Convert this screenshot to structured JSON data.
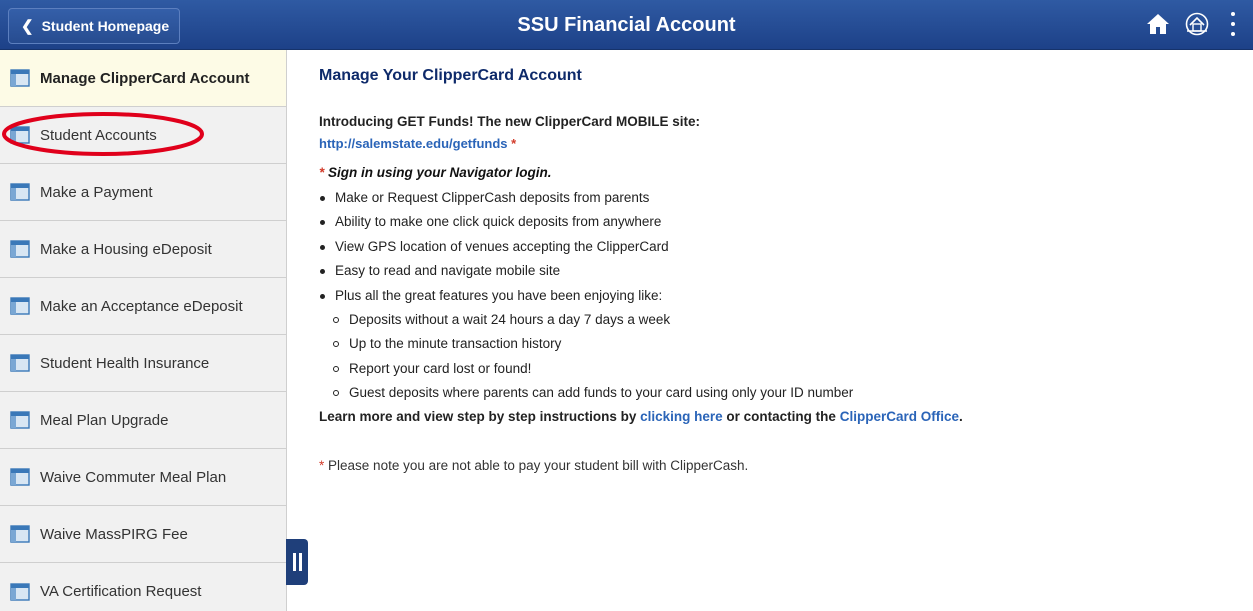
{
  "header": {
    "back_label": "Student Homepage",
    "title": "SSU Financial Account",
    "icons": [
      "home-icon",
      "navbar-icon",
      "actions-menu-icon"
    ],
    "bg_color": "#1d4188"
  },
  "sidebar": {
    "items": [
      {
        "label": "Manage ClipperCard Account",
        "active": true
      },
      {
        "label": "Student Accounts"
      },
      {
        "label": "Make a Payment"
      },
      {
        "label": "Make a Housing eDeposit"
      },
      {
        "label": "Make an Acceptance eDeposit"
      },
      {
        "label": "Student Health Insurance"
      },
      {
        "label": "Meal Plan Upgrade"
      },
      {
        "label": "Waive Commuter Meal Plan"
      },
      {
        "label": "Waive MassPIRG Fee"
      },
      {
        "label": "VA Certification Request"
      }
    ],
    "active_bg": "#fdfbe6",
    "annotation_color": "#e0001b"
  },
  "main": {
    "title": "Manage Your ClipperCard Account",
    "intro": "Introducing GET Funds! The new ClipperCard MOBILE site:",
    "intro_link": "http://salemstate.edu/getfunds",
    "asterisk": "*",
    "signin": "Sign in using your Navigator login.",
    "bullets": [
      "Make or Request ClipperCash deposits from parents",
      "Ability to make one click quick deposits from anywhere",
      "View GPS location of venues accepting the ClipperCard",
      "Easy to read and navigate mobile site",
      "Plus all the great features you have been enjoying like:"
    ],
    "sub_bullets": [
      "Deposits without a wait 24 hours a day 7 days a week",
      "Up to the minute transaction history",
      "Report your card lost or found!",
      "Guest deposits where parents can add funds to your card using only your ID number"
    ],
    "learn_prefix": "Learn more and view step by step instructions by",
    "learn_link1": "clicking here",
    "learn_middle": "or contacting the",
    "learn_link2": "ClipperCard Office",
    "learn_suffix": ".",
    "note": "Please note you are not able to pay your student bill with ClipperCash."
  },
  "colors": {
    "link": "#2a64b8",
    "title": "#0e2a6a",
    "asterisk": "#d23b2a"
  }
}
